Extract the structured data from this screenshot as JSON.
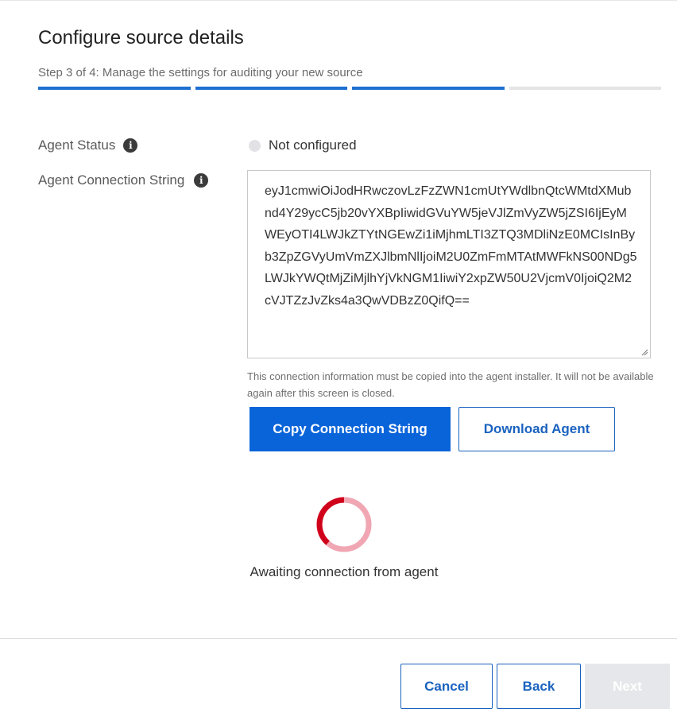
{
  "dialog": {
    "title": "Configure source details",
    "subtitle": "Step 3 of 4: Manage the settings for auditing your new source",
    "progress": {
      "current_step": 3,
      "total_steps": 4
    }
  },
  "agent_status": {
    "label": "Agent Status",
    "value": "Not configured",
    "info_icon": "info-icon"
  },
  "connection": {
    "label": "Agent Connection String",
    "info_icon": "info-icon",
    "value": "eyJ1cmwiOiJodHRwczovLzFzZWN1cmUtYWdlbnQtcWMtdXMubnd4Y29ycC5jb20vYXBpIiwidGVuYW5jeVJlZmVyZW5jZSI6IjEyMWEyOTI4LWJkZTYtNGEwZi1iMjhmLTI3ZTQ3MDliNzE0MCIsInByb3ZpZGVyUmVmZXJlbmNlIjoiM2U0ZmFmMTAtMWFkNS00NDg5LWJkYWQtMjZiMjlhYjVkNGM1IiwiY2xpZW50U2VjcmV0IjoiQ2M2cVJTZzJvZks4a3QwVDBzZ0QifQ==",
    "helper": "This connection information must be copied into the agent installer. It will not be available again after this screen is closed.",
    "copy_button": "Copy Connection String",
    "download_button": "Download Agent"
  },
  "awaiting": {
    "text": "Awaiting connection from agent",
    "spinner_colors": {
      "track": "#f0a7b3",
      "arc": "#d0021b"
    }
  },
  "footer": {
    "cancel": "Cancel",
    "back": "Back",
    "next": "Next",
    "next_disabled": true
  },
  "colors": {
    "accent": "#0a64d9",
    "progress_done": "#1d6fd1",
    "progress_todo": "#e4e4e4"
  }
}
